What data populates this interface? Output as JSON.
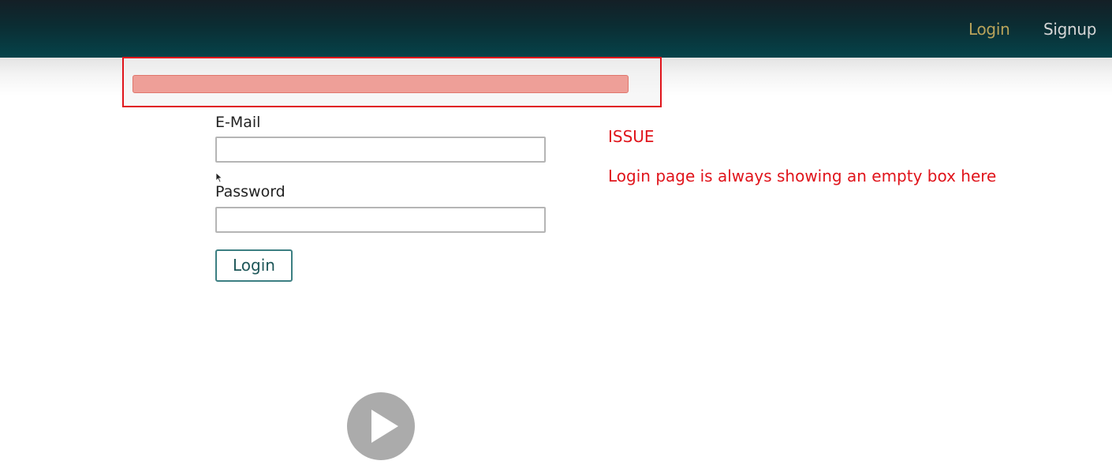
{
  "navbar": {
    "login_label": "Login",
    "signup_label": "Signup"
  },
  "form": {
    "email_label": "E-Mail",
    "email_value": "",
    "password_label": "Password",
    "password_value": "",
    "login_button_label": "Login"
  },
  "annotation": {
    "title": "ISSUE",
    "text": "Login page is always showing an empty box here",
    "color": "#e0141b"
  },
  "icons": {
    "cursor": "mouse-cursor-icon",
    "play": "play-icon"
  },
  "colors": {
    "navbar": "#0b2d33",
    "nav_active": "#b9a35a",
    "alert_fill": "#ee9f98",
    "button_border": "#3c7f82"
  }
}
